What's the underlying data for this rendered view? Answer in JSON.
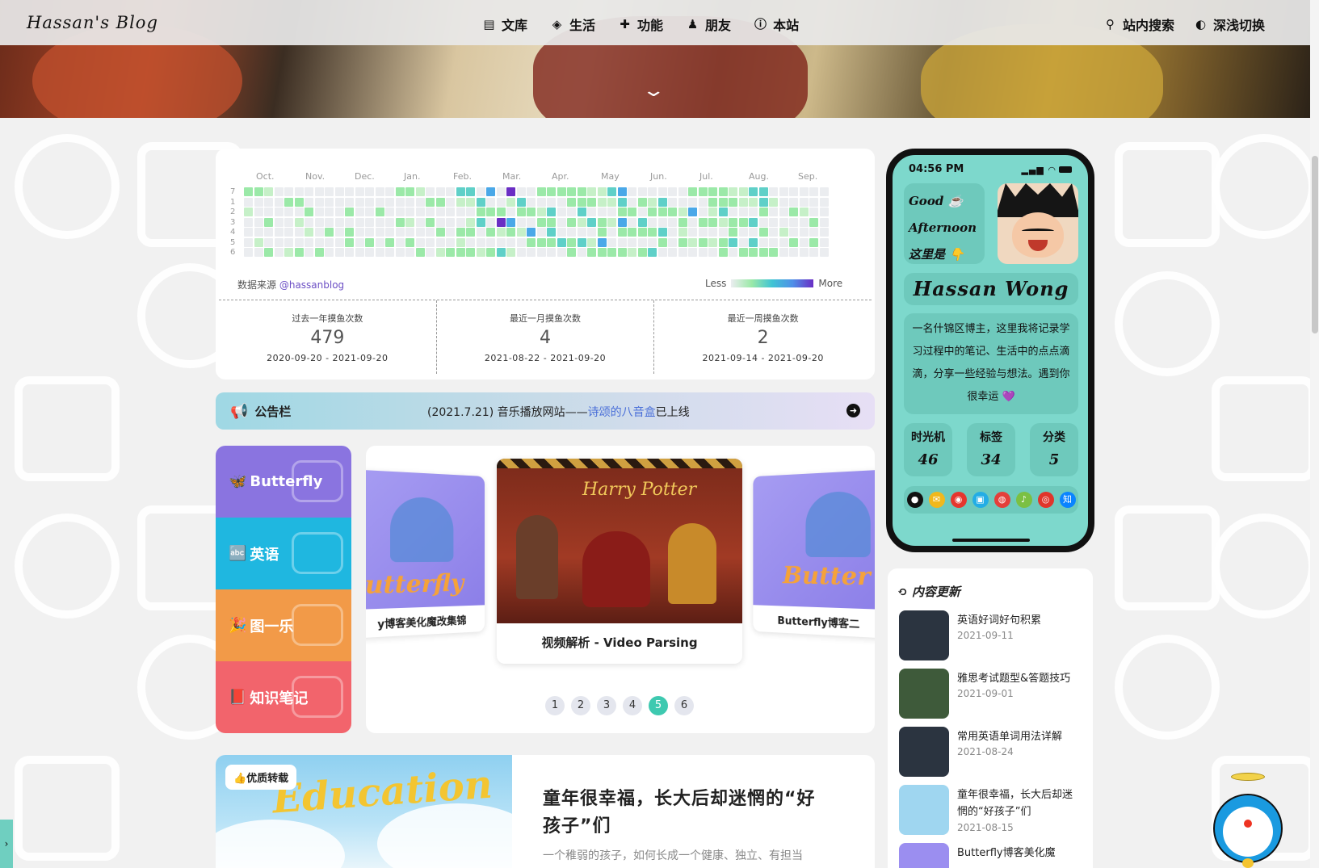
{
  "nav": {
    "brand": "Hassan's Blog",
    "menu": [
      {
        "icon": "book-icon",
        "glyph": "▤",
        "label": "文库"
      },
      {
        "icon": "cube-icon",
        "glyph": "◈",
        "label": "生活"
      },
      {
        "icon": "puzzle-icon",
        "glyph": "✚",
        "label": "功能"
      },
      {
        "icon": "person-icon",
        "glyph": "♟",
        "label": "朋友"
      },
      {
        "icon": "info-icon",
        "glyph": "ⓘ",
        "label": "本站"
      }
    ],
    "search_label": "站内搜索",
    "theme_label": "深浅切换"
  },
  "heatmap": {
    "months": [
      "Oct.",
      "Nov.",
      "Dec.",
      "Jan.",
      "Feb.",
      "Mar.",
      "Apr.",
      "May",
      "Jun.",
      "Jul.",
      "Aug.",
      "Sep."
    ],
    "days": [
      "7",
      "1",
      "2",
      "3",
      "4",
      "5",
      "6"
    ],
    "source_label": "数据来源",
    "source_handle": "@hassanblog",
    "legend_less": "Less",
    "legend_more": "More",
    "colors": [
      "#ebedf0",
      "#c6f0c8",
      "#9be9a8",
      "#5fd0c8",
      "#4aa8e8",
      "#6a2ec4"
    ],
    "stats": [
      {
        "label": "过去一年摸鱼次数",
        "count": "479",
        "range": "2020-09-20 - 2021-09-20"
      },
      {
        "label": "最近一月摸鱼次数",
        "count": "4",
        "range": "2021-08-22 - 2021-09-20"
      },
      {
        "label": "最近一周摸鱼次数",
        "count": "2",
        "range": "2021-09-14 - 2021-09-20"
      }
    ]
  },
  "notice": {
    "title": "公告栏",
    "message_prefix": "(2021.7.21) 音乐播放网站——",
    "message_link": "诗颂的八音盒",
    "message_suffix": "已上线"
  },
  "categories": [
    {
      "label": "Butterfly",
      "icon": "butterfly-icon",
      "glyph": "🦋",
      "color": "#8a74e0"
    },
    {
      "label": "英语",
      "icon": "abc-icon",
      "glyph": "🔤",
      "color": "#1fb7e0"
    },
    {
      "label": "图一乐",
      "icon": "party-icon",
      "glyph": "🎉",
      "color": "#f29a48"
    },
    {
      "label": "知识笔记",
      "icon": "notebook-icon",
      "glyph": "📕",
      "color": "#f2646c"
    }
  ],
  "carousel": {
    "slides": [
      {
        "caption": "y博客美化魔改集锦"
      },
      {
        "caption": "视频解析 - Video Parsing",
        "image_text": "Harry Potter"
      },
      {
        "caption": "Butterfly博客二"
      }
    ],
    "pages": [
      "1",
      "2",
      "3",
      "4",
      "5",
      "6"
    ],
    "active_page": "5"
  },
  "post": {
    "badge": "👍优质转载",
    "image_word": "Education",
    "title": "童年很幸福，长大后却迷惘的“好孩子”们",
    "desc": "一个稚弱的孩子，如何长成一个健康、独立、有担当"
  },
  "profile": {
    "time": "04:56 PM",
    "greeting": [
      "Good ☕",
      "Afternoon",
      "这里是 👇"
    ],
    "name": "Hassan Wong",
    "bio": "一名什锦区博主，这里我将记录学习过程中的笔记、生活中的点点滴滴，分享一些经验与想法。遇到你很幸运 💜",
    "stats": [
      {
        "label": "时光机",
        "value": "46"
      },
      {
        "label": "标签",
        "value": "34"
      },
      {
        "label": "分类",
        "value": "5"
      }
    ],
    "socials": [
      {
        "icon": "github-icon",
        "glyph": "●",
        "color": "#111"
      },
      {
        "icon": "mail-icon",
        "glyph": "✉",
        "color": "#f1b81c"
      },
      {
        "icon": "weibo-icon",
        "glyph": "◉",
        "color": "#e6362e"
      },
      {
        "icon": "bilibili-icon",
        "glyph": "▣",
        "color": "#23ade5"
      },
      {
        "icon": "qq-icon",
        "glyph": "◍",
        "color": "#e43f3a"
      },
      {
        "icon": "music-icon",
        "glyph": "♪",
        "color": "#7bc043"
      },
      {
        "icon": "netease-icon",
        "glyph": "◎",
        "color": "#e0352b"
      },
      {
        "icon": "zhihu-icon",
        "glyph": "知",
        "color": "#0a84ff"
      }
    ]
  },
  "updates": {
    "title": "内容更新",
    "items": [
      {
        "title": "英语好词好句积累",
        "date": "2021-09-11",
        "thumb": "#2b3440"
      },
      {
        "title": "雅思考试题型&答题技巧",
        "date": "2021-09-01",
        "thumb": "#3e5a3a"
      },
      {
        "title": "常用英语单词用法详解",
        "date": "2021-08-24",
        "thumb": "#2b3440"
      },
      {
        "title": "童年很幸福，长大后却迷惘的“好孩子”们",
        "date": "2021-08-15",
        "thumb": "#9fd6f0"
      },
      {
        "title": "Butterfly博客美化魔",
        "date": "",
        "thumb": "#9b8ef0"
      }
    ]
  }
}
